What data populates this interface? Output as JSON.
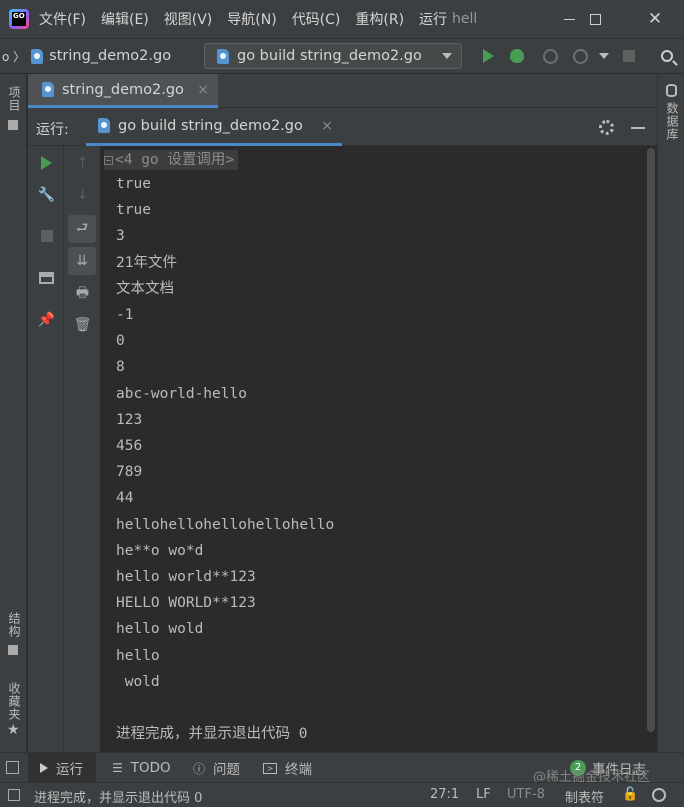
{
  "app": {
    "logo_text": "GO",
    "menu": [
      "文件(F)",
      "编辑(E)",
      "视图(V)",
      "导航(N)",
      "代码(C)",
      "重构(R)",
      "运行"
    ],
    "title": "hell"
  },
  "navbar": {
    "breadcrumb_file": "string_demo2.go",
    "run_config": "go build string_demo2.go"
  },
  "left_strip": {
    "project_label": "项目",
    "structure_label": "结构",
    "favorites_label": "收藏夹"
  },
  "right_strip": {
    "database_label": "数据库"
  },
  "editor_tab": {
    "label": "string_demo2.go",
    "close": "×"
  },
  "run_panel": {
    "prefix": "运行:",
    "tab_label": "go build string_demo2.go",
    "tab_close": "×",
    "fold_label": "<4 go 设置调用>",
    "output_lines": [
      "true",
      "true",
      "3",
      "21年文件",
      "文本文档",
      "-1",
      "0",
      "8",
      "abc-world-hello",
      "123",
      "456",
      "789",
      "44",
      "hellohellohellohellohello",
      "he**o wo*d",
      "hello world**123",
      "HELLO WORLD**123",
      "hello wold",
      "hello",
      " wold",
      "",
      "进程完成，并显示退出代码 0"
    ]
  },
  "bottom_tabs": {
    "run": "运行",
    "todo": "TODO",
    "problems": "问题",
    "terminal": "终端",
    "event_log": "事件日志",
    "event_count": "2"
  },
  "watermark": "@稀土掘金技术社区",
  "status": {
    "message": "进程完成，并显示退出代码 0",
    "position": "27:1",
    "line_sep": "LF",
    "encoding": "UTF-8",
    "indent": "制表符"
  },
  "colors": {
    "accent": "#4a88c7",
    "run_green": "#499c54",
    "background": "#2b2b2b",
    "panel": "#3c3f41"
  }
}
